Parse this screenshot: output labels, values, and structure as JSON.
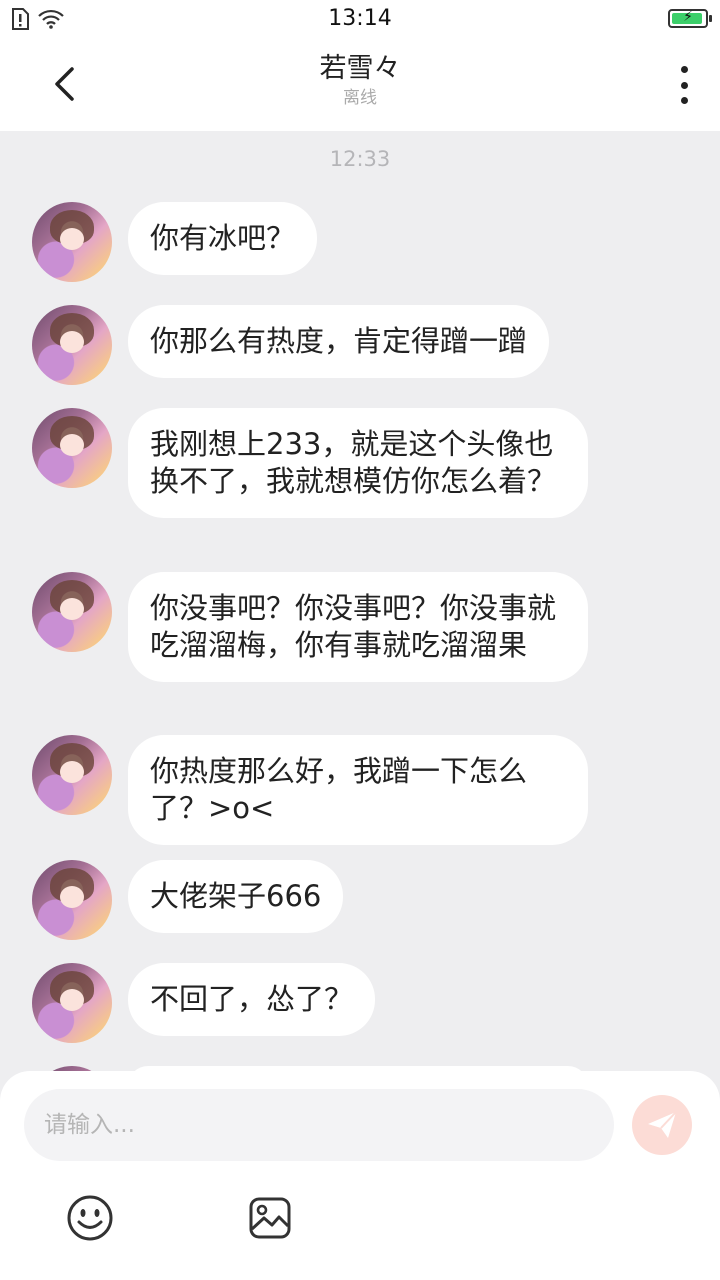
{
  "status_bar": {
    "time": "13:14",
    "icons": [
      "sim-alert-icon",
      "wifi-icon",
      "battery-charging-icon"
    ],
    "battery_level_percent": 95
  },
  "header": {
    "back_icon": "chevron-left-icon",
    "contact_name": "若雪々",
    "contact_status": "离线",
    "more_icon": "more-vertical-icon"
  },
  "chat": {
    "timestamp": "12:33",
    "messages": [
      {
        "text": "你有冰吧？"
      },
      {
        "text": "你那么有热度，肯定得蹭一蹭"
      },
      {
        "text": "我刚想上233，就是这个头像也换不了，我就想模仿你怎么着？"
      },
      {
        "text": "你没事吧？你没事吧？你没事就吃溜溜梅，你有事就吃溜溜果"
      },
      {
        "text": "你热度那么好，我蹭一下怎么了？>o<"
      },
      {
        "text": "大佬架子666"
      },
      {
        "text": "不回了，怂了？"
      }
    ]
  },
  "composer": {
    "placeholder": "请输入...",
    "value": "",
    "send_icon": "send-icon",
    "emoji_icon": "emoji-icon",
    "image_icon": "image-icon"
  },
  "colors": {
    "page_background": "#eeeef0",
    "bubble_background": "#ffffff",
    "send_button": "#fcdcd6",
    "battery_fill": "#3ccf6a"
  }
}
